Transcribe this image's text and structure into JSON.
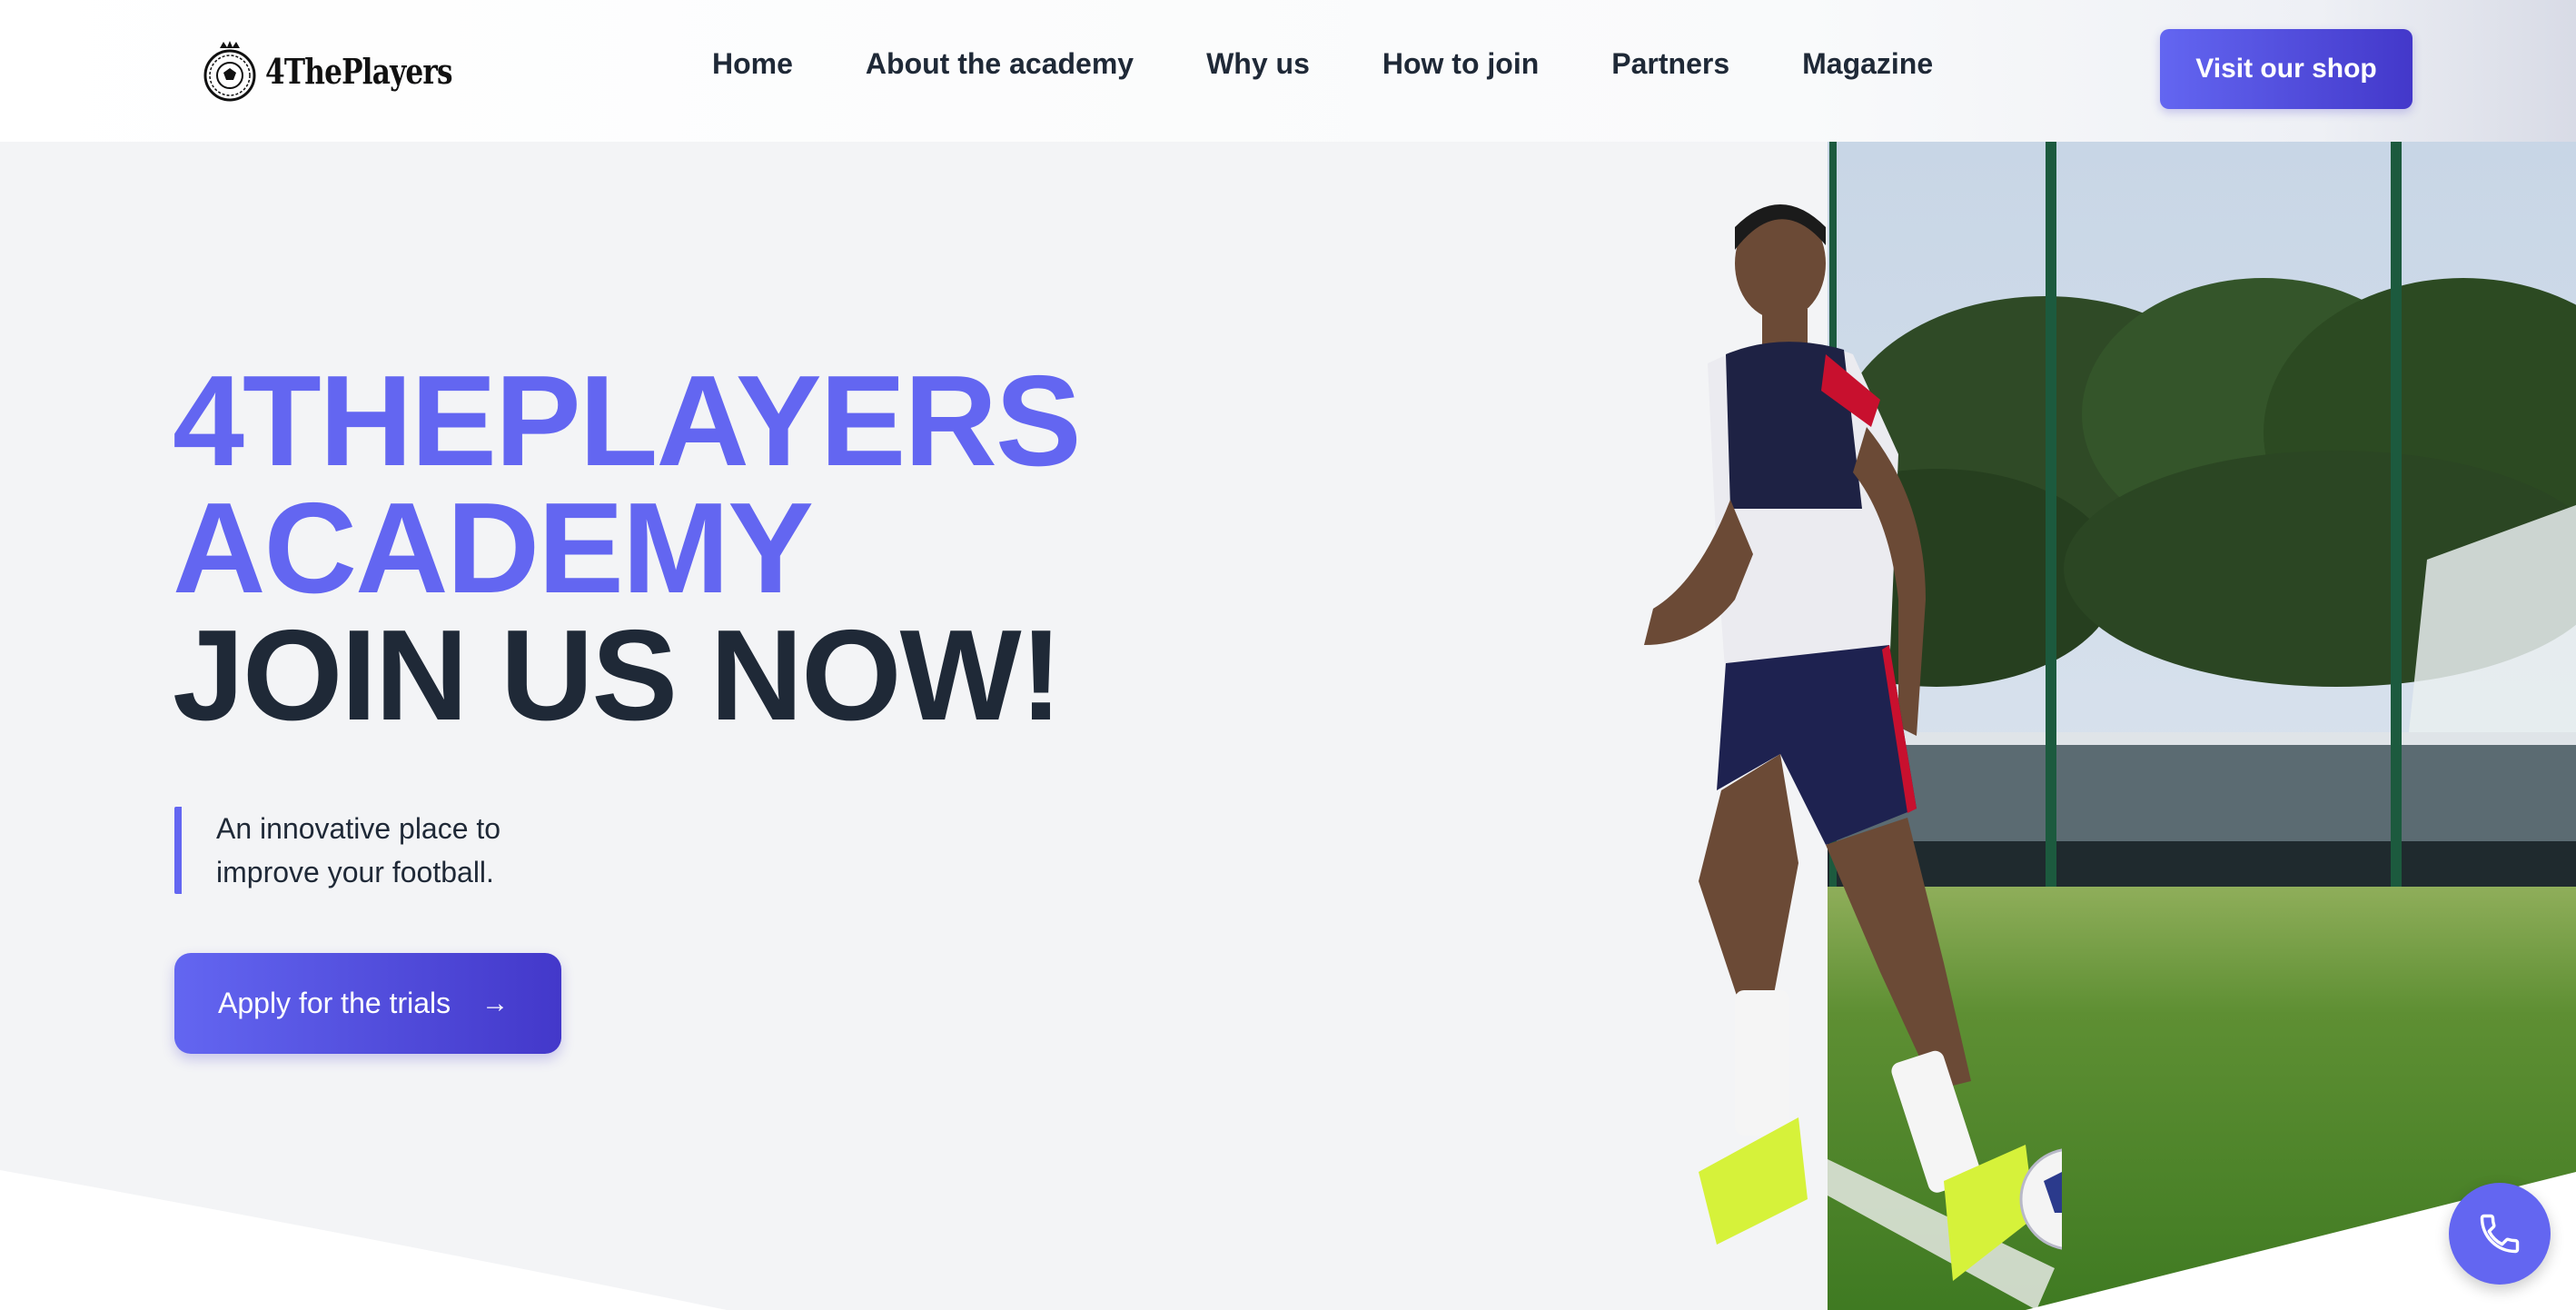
{
  "header": {
    "logo_text": "4ThePlayers",
    "nav": [
      {
        "label": "Home"
      },
      {
        "label": "About the academy"
      },
      {
        "label": "Why us"
      },
      {
        "label": "How to join"
      },
      {
        "label": "Partners"
      },
      {
        "label": "Magazine"
      }
    ],
    "shop_button": "Visit our shop"
  },
  "hero": {
    "title_line1": "4THEPLAYERS",
    "title_line2": "ACADEMY",
    "title_line3": "JOIN US NOW!",
    "tagline_line1": "An innovative place to",
    "tagline_line2": "improve your football.",
    "cta_label": "Apply for the trials",
    "cta_icon": "arrow-right-icon"
  },
  "floating": {
    "call_icon": "phone-icon"
  },
  "colors": {
    "accent": "#6366f1",
    "accent_dark": "#4338ca",
    "text_dark": "#1f2937",
    "hero_bg": "#f3f4f6"
  }
}
